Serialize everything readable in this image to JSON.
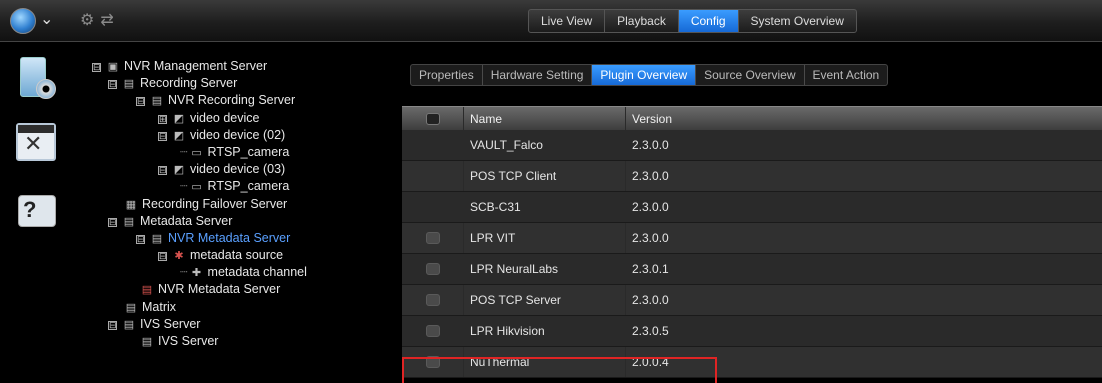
{
  "topnav": {
    "tabs": [
      {
        "label": "Live View"
      },
      {
        "label": "Playback"
      },
      {
        "label": "Config"
      },
      {
        "label": "System Overview"
      }
    ],
    "active": "Config"
  },
  "tree": {
    "nodes": [
      {
        "label": "NVR Management Server",
        "toggle": "⊟"
      },
      {
        "label": "Recording Server",
        "toggle": "⊟"
      },
      {
        "label": "NVR Recording Server",
        "toggle": "⊟"
      },
      {
        "label": "video device",
        "toggle": "⊞"
      },
      {
        "label": "video device (02)",
        "toggle": "⊟"
      },
      {
        "label": "RTSP_camera"
      },
      {
        "label": "video device (03)",
        "toggle": "⊟"
      },
      {
        "label": "RTSP_camera"
      },
      {
        "label": "Recording Failover Server"
      },
      {
        "label": "Metadata Server",
        "toggle": "⊟"
      },
      {
        "label": "NVR Metadata Server",
        "toggle": "⊟"
      },
      {
        "label": "metadata source",
        "toggle": "⊟"
      },
      {
        "label": "metadata channel"
      },
      {
        "label": "NVR Metadata Server"
      },
      {
        "label": "Matrix"
      },
      {
        "label": "IVS Server",
        "toggle": "⊟"
      },
      {
        "label": "IVS Server"
      }
    ]
  },
  "subtabs": {
    "tabs": [
      {
        "label": "Properties"
      },
      {
        "label": "Hardware Setting"
      },
      {
        "label": "Plugin Overview"
      },
      {
        "label": "Source Overview"
      },
      {
        "label": "Event Action"
      }
    ],
    "active": "Plugin Overview"
  },
  "grid": {
    "headers": {
      "name": "Name",
      "version": "Version"
    },
    "rows": [
      {
        "name": "VAULT_Falco",
        "version": "2.3.0.0",
        "checkbox": false
      },
      {
        "name": "POS TCP Client",
        "version": "2.3.0.0",
        "checkbox": false
      },
      {
        "name": "SCB-C31",
        "version": "2.3.0.0",
        "checkbox": false
      },
      {
        "name": "LPR VIT",
        "version": "2.3.0.0",
        "checkbox": true
      },
      {
        "name": "LPR NeuralLabs",
        "version": "2.3.0.1",
        "checkbox": true
      },
      {
        "name": "POS TCP Server",
        "version": "2.3.0.0",
        "checkbox": true
      },
      {
        "name": "LPR Hikvision",
        "version": "2.3.0.5",
        "checkbox": true
      },
      {
        "name": "NuThermal",
        "version": "2.0.0.4",
        "checkbox": true
      }
    ]
  },
  "colors": {
    "accent": "#1f7ff0",
    "highlight_box": "#e02424",
    "tree_selected": "#5aa0ff"
  }
}
